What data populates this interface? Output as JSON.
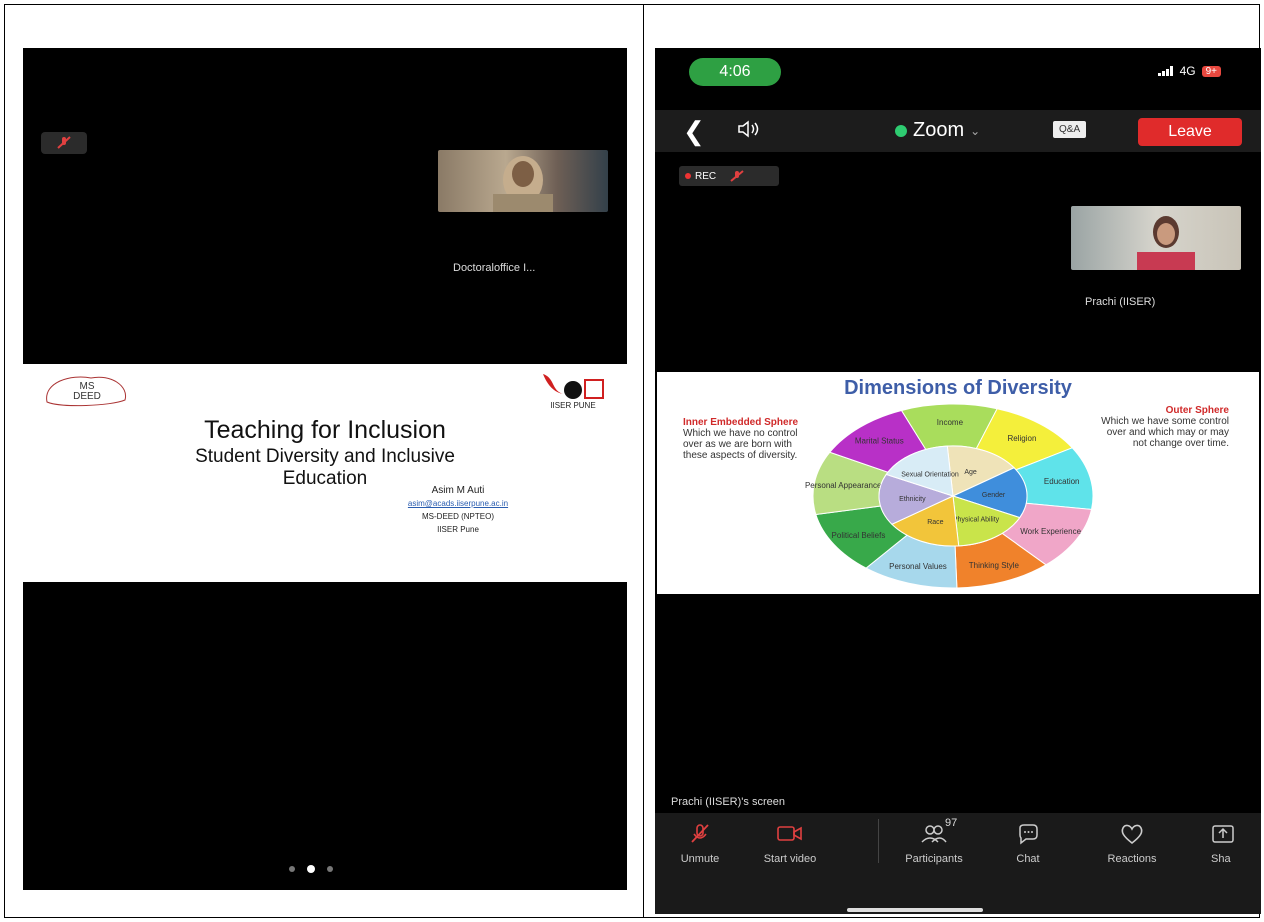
{
  "left": {
    "participant_name": "Doctoraloffice I...",
    "slide": {
      "logo_left": "MS DEED",
      "logo_right": "IISER PUNE",
      "title": "Teaching for Inclusion",
      "subtitle_line1": "Student Diversity and Inclusive",
      "subtitle_line2": "Education",
      "author_name": "Asim M Auti",
      "author_email": "asim@acads.iiserpune.ac.in",
      "author_dept": "MS-DEED (NPTEO)",
      "author_inst": "IISER Pune"
    },
    "pager": {
      "count": 3,
      "active_index": 1
    }
  },
  "right": {
    "status": {
      "time": "4:06",
      "network": "4G",
      "battery": "9+"
    },
    "topbar": {
      "app_name": "Zoom",
      "qa_label": "Q&A",
      "leave_label": "Leave"
    },
    "rec_label": "REC",
    "participant_name": "Prachi (IISER)",
    "slide": {
      "title": "Dimensions of Diversity",
      "inner_heading": "Inner Embedded Sphere",
      "inner_text": "Which we have no control over as we are born with these aspects of diversity.",
      "outer_heading": "Outer Sphere",
      "outer_text": "Which we have some control over and which may or may not change over time.",
      "outer_ring": [
        "Income",
        "Religion",
        "Education",
        "Work Experience",
        "Thinking Style",
        "Personal Values",
        "Political Beliefs",
        "Personal Appearance",
        "Marital Status"
      ],
      "inner_ring": [
        "Age",
        "Gender",
        "Physical Ability",
        "Race",
        "Ethnicity",
        "Sexual Orientation"
      ],
      "colors": {
        "outer": [
          "#a9dd5c",
          "#f4ef3b",
          "#5fe3ea",
          "#f0a6c8",
          "#f0822b",
          "#a7d8ec",
          "#38a94a",
          "#b9de82",
          "#b830c7"
        ],
        "inner": [
          "#efe3b8",
          "#3f8edc",
          "#c9e44a",
          "#f2c53a",
          "#b7acdb",
          "#d8ecf6"
        ]
      }
    },
    "caption": "Prachi (IISER)'s screen",
    "toolbar": [
      {
        "label": "Unmute",
        "icon": "mic-off-icon"
      },
      {
        "label": "Start video",
        "icon": "video-off-icon"
      },
      {
        "label": "Participants",
        "icon": "participants-icon",
        "badge": "97"
      },
      {
        "label": "Chat",
        "icon": "chat-icon"
      },
      {
        "label": "Reactions",
        "icon": "heart-icon"
      },
      {
        "label": "Sha",
        "icon": "share-icon"
      }
    ]
  }
}
